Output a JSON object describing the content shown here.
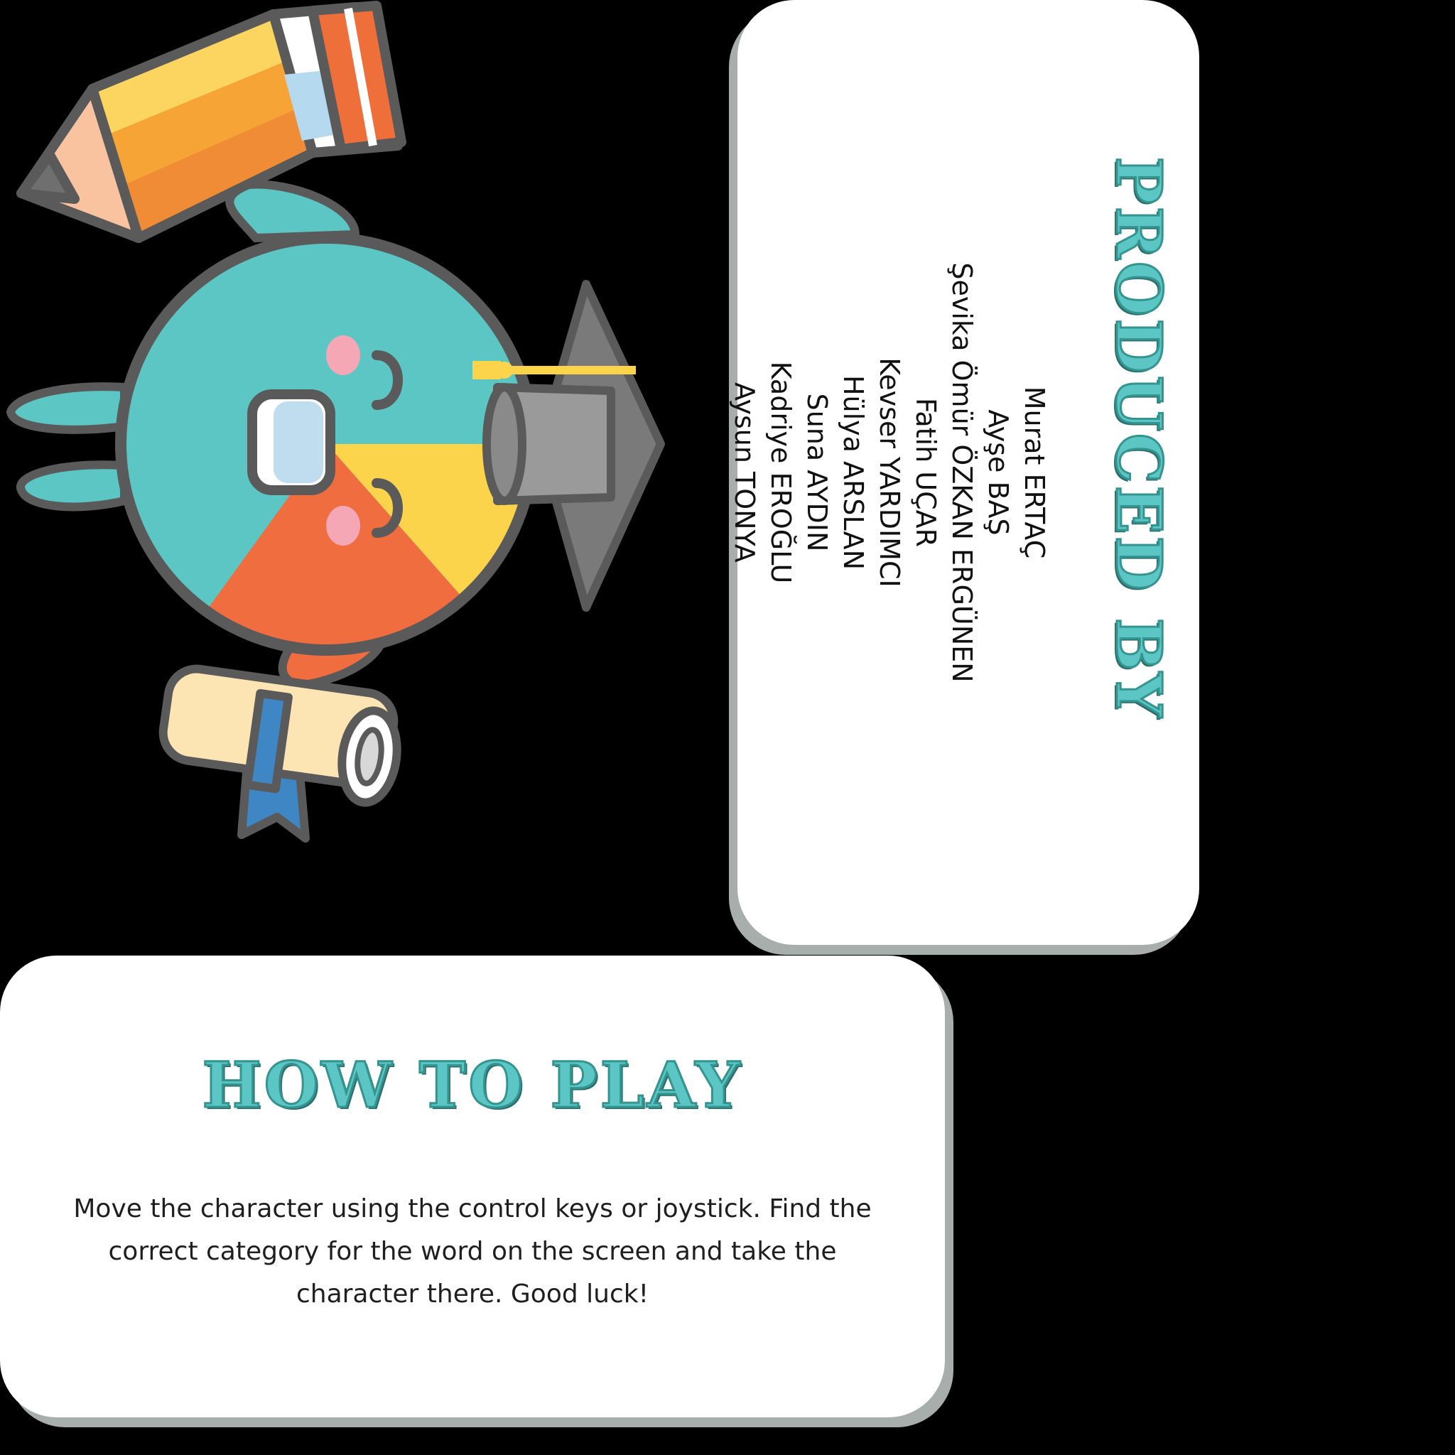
{
  "credits": {
    "title": "PRODUCED BY",
    "names": [
      "Murat ERTAÇ",
      "Ayşe BAŞ",
      "Şevika Ömür ÖZKAN ERGÜNEN",
      "Fatih UÇAR",
      "Kevser YARDIMCI",
      "Hülya ARSLAN",
      "Suna AYDIN",
      "Kadriye EROĞLU",
      "Aysun TONYA"
    ]
  },
  "howto": {
    "title": "HOW TO PLAY",
    "body": "Move the character using the control keys or joystick. Find the correct category for the word on the screen and take the character there. Good luck!"
  },
  "colors": {
    "accent_teal": "#5cc6c4",
    "card_shadow": "#a8aeab",
    "background": "#000000"
  }
}
